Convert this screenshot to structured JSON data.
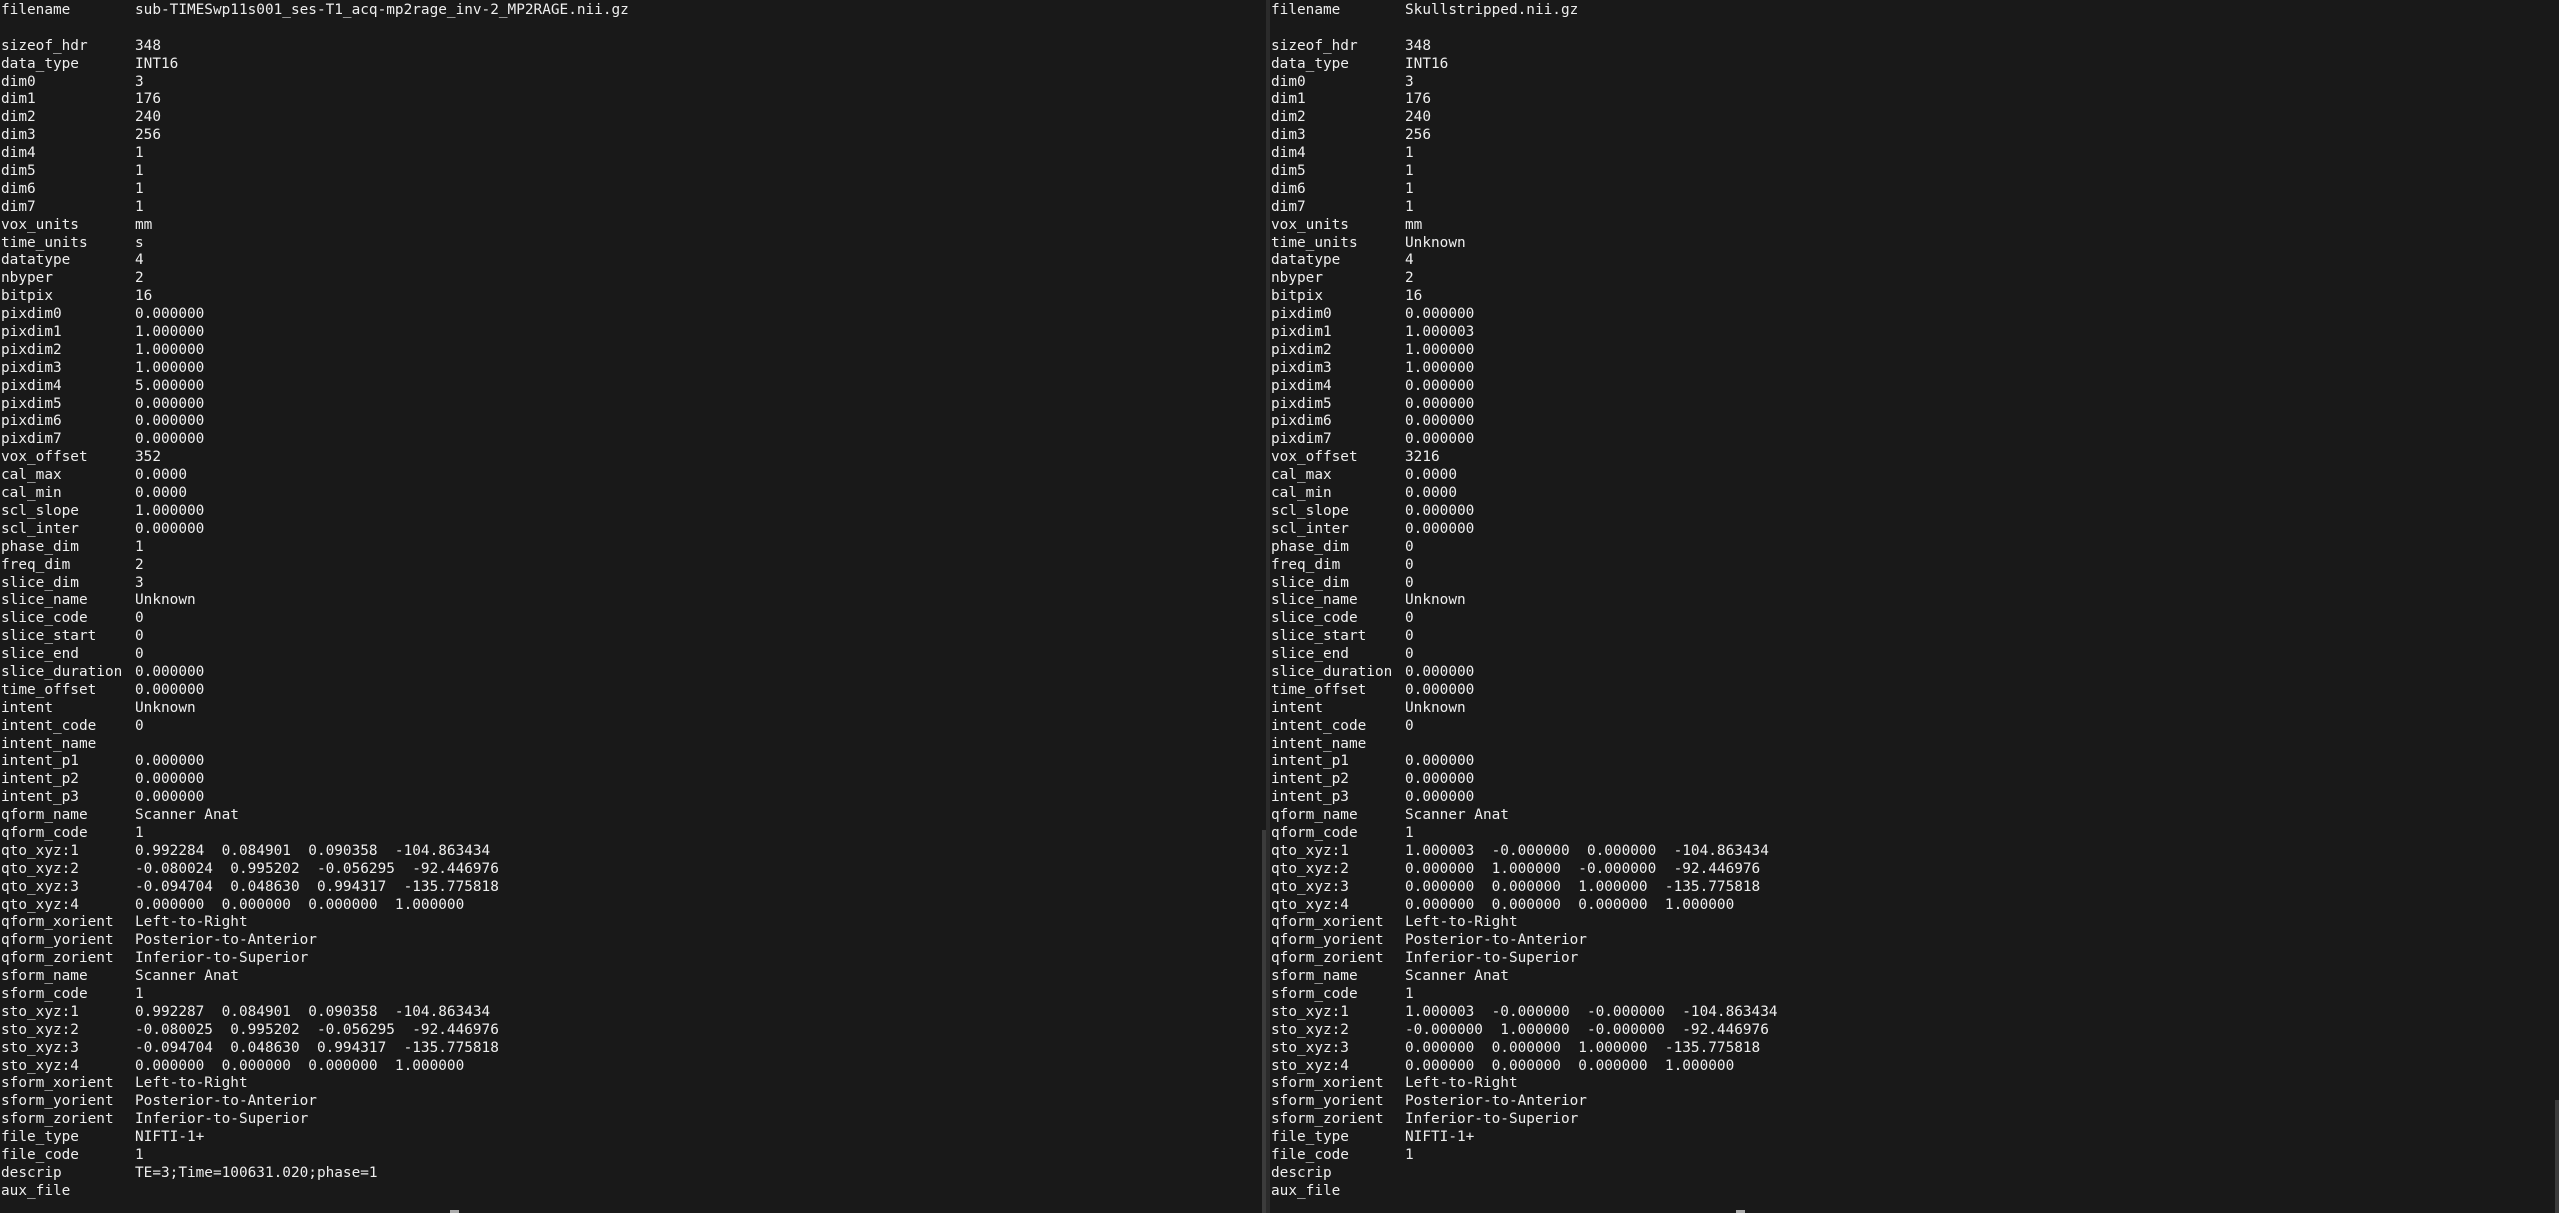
{
  "left_terminal": {
    "rows": [
      {
        "key": "filename",
        "value": "sub-TIMESwp11s001_ses-T1_acq-mp2rage_inv-2_MP2RAGE.nii.gz"
      },
      {
        "key": "",
        "value": ""
      },
      {
        "key": "sizeof_hdr",
        "value": "348"
      },
      {
        "key": "data_type",
        "value": "INT16"
      },
      {
        "key": "dim0",
        "value": "3"
      },
      {
        "key": "dim1",
        "value": "176"
      },
      {
        "key": "dim2",
        "value": "240"
      },
      {
        "key": "dim3",
        "value": "256"
      },
      {
        "key": "dim4",
        "value": "1"
      },
      {
        "key": "dim5",
        "value": "1"
      },
      {
        "key": "dim6",
        "value": "1"
      },
      {
        "key": "dim7",
        "value": "1"
      },
      {
        "key": "vox_units",
        "value": "mm"
      },
      {
        "key": "time_units",
        "value": "s"
      },
      {
        "key": "datatype",
        "value": "4"
      },
      {
        "key": "nbyper",
        "value": "2"
      },
      {
        "key": "bitpix",
        "value": "16"
      },
      {
        "key": "pixdim0",
        "value": "0.000000"
      },
      {
        "key": "pixdim1",
        "value": "1.000000"
      },
      {
        "key": "pixdim2",
        "value": "1.000000"
      },
      {
        "key": "pixdim3",
        "value": "1.000000"
      },
      {
        "key": "pixdim4",
        "value": "5.000000"
      },
      {
        "key": "pixdim5",
        "value": "0.000000"
      },
      {
        "key": "pixdim6",
        "value": "0.000000"
      },
      {
        "key": "pixdim7",
        "value": "0.000000"
      },
      {
        "key": "vox_offset",
        "value": "352"
      },
      {
        "key": "cal_max",
        "value": "0.0000"
      },
      {
        "key": "cal_min",
        "value": "0.0000"
      },
      {
        "key": "scl_slope",
        "value": "1.000000"
      },
      {
        "key": "scl_inter",
        "value": "0.000000"
      },
      {
        "key": "phase_dim",
        "value": "1"
      },
      {
        "key": "freq_dim",
        "value": "2"
      },
      {
        "key": "slice_dim",
        "value": "3"
      },
      {
        "key": "slice_name",
        "value": "Unknown"
      },
      {
        "key": "slice_code",
        "value": "0"
      },
      {
        "key": "slice_start",
        "value": "0"
      },
      {
        "key": "slice_end",
        "value": "0"
      },
      {
        "key": "slice_duration",
        "value": "0.000000"
      },
      {
        "key": "time_offset",
        "value": "0.000000"
      },
      {
        "key": "intent",
        "value": "Unknown"
      },
      {
        "key": "intent_code",
        "value": "0"
      },
      {
        "key": "intent_name",
        "value": ""
      },
      {
        "key": "intent_p1",
        "value": "0.000000"
      },
      {
        "key": "intent_p2",
        "value": "0.000000"
      },
      {
        "key": "intent_p3",
        "value": "0.000000"
      },
      {
        "key": "qform_name",
        "value": "Scanner Anat"
      },
      {
        "key": "qform_code",
        "value": "1"
      },
      {
        "key": "qto_xyz:1",
        "value": "0.992284  0.084901  0.090358  -104.863434"
      },
      {
        "key": "qto_xyz:2",
        "value": "-0.080024  0.995202  -0.056295  -92.446976"
      },
      {
        "key": "qto_xyz:3",
        "value": "-0.094704  0.048630  0.994317  -135.775818"
      },
      {
        "key": "qto_xyz:4",
        "value": "0.000000  0.000000  0.000000  1.000000"
      },
      {
        "key": "qform_xorient",
        "value": "Left-to-Right"
      },
      {
        "key": "qform_yorient",
        "value": "Posterior-to-Anterior"
      },
      {
        "key": "qform_zorient",
        "value": "Inferior-to-Superior"
      },
      {
        "key": "sform_name",
        "value": "Scanner Anat"
      },
      {
        "key": "sform_code",
        "value": "1"
      },
      {
        "key": "sto_xyz:1",
        "value": "0.992287  0.084901  0.090358  -104.863434"
      },
      {
        "key": "sto_xyz:2",
        "value": "-0.080025  0.995202  -0.056295  -92.446976"
      },
      {
        "key": "sto_xyz:3",
        "value": "-0.094704  0.048630  0.994317  -135.775818"
      },
      {
        "key": "sto_xyz:4",
        "value": "0.000000  0.000000  0.000000  1.000000"
      },
      {
        "key": "sform_xorient",
        "value": "Left-to-Right"
      },
      {
        "key": "sform_yorient",
        "value": "Posterior-to-Anterior"
      },
      {
        "key": "sform_zorient",
        "value": "Inferior-to-Superior"
      },
      {
        "key": "file_type",
        "value": "NIFTI-1+"
      },
      {
        "key": "file_code",
        "value": "1"
      },
      {
        "key": "descrip",
        "value": "TE=3;Time=100631.020;phase=1"
      },
      {
        "key": "aux_file",
        "value": ""
      }
    ]
  },
  "right_terminal": {
    "rows": [
      {
        "key": "filename",
        "value": "Skullstripped.nii.gz"
      },
      {
        "key": "",
        "value": ""
      },
      {
        "key": "sizeof_hdr",
        "value": "348"
      },
      {
        "key": "data_type",
        "value": "INT16"
      },
      {
        "key": "dim0",
        "value": "3"
      },
      {
        "key": "dim1",
        "value": "176"
      },
      {
        "key": "dim2",
        "value": "240"
      },
      {
        "key": "dim3",
        "value": "256"
      },
      {
        "key": "dim4",
        "value": "1"
      },
      {
        "key": "dim5",
        "value": "1"
      },
      {
        "key": "dim6",
        "value": "1"
      },
      {
        "key": "dim7",
        "value": "1"
      },
      {
        "key": "vox_units",
        "value": "mm"
      },
      {
        "key": "time_units",
        "value": "Unknown"
      },
      {
        "key": "datatype",
        "value": "4"
      },
      {
        "key": "nbyper",
        "value": "2"
      },
      {
        "key": "bitpix",
        "value": "16"
      },
      {
        "key": "pixdim0",
        "value": "0.000000"
      },
      {
        "key": "pixdim1",
        "value": "1.000003"
      },
      {
        "key": "pixdim2",
        "value": "1.000000"
      },
      {
        "key": "pixdim3",
        "value": "1.000000"
      },
      {
        "key": "pixdim4",
        "value": "0.000000"
      },
      {
        "key": "pixdim5",
        "value": "0.000000"
      },
      {
        "key": "pixdim6",
        "value": "0.000000"
      },
      {
        "key": "pixdim7",
        "value": "0.000000"
      },
      {
        "key": "vox_offset",
        "value": "3216"
      },
      {
        "key": "cal_max",
        "value": "0.0000"
      },
      {
        "key": "cal_min",
        "value": "0.0000"
      },
      {
        "key": "scl_slope",
        "value": "0.000000"
      },
      {
        "key": "scl_inter",
        "value": "0.000000"
      },
      {
        "key": "phase_dim",
        "value": "0"
      },
      {
        "key": "freq_dim",
        "value": "0"
      },
      {
        "key": "slice_dim",
        "value": "0"
      },
      {
        "key": "slice_name",
        "value": "Unknown"
      },
      {
        "key": "slice_code",
        "value": "0"
      },
      {
        "key": "slice_start",
        "value": "0"
      },
      {
        "key": "slice_end",
        "value": "0"
      },
      {
        "key": "slice_duration",
        "value": "0.000000"
      },
      {
        "key": "time_offset",
        "value": "0.000000"
      },
      {
        "key": "intent",
        "value": "Unknown"
      },
      {
        "key": "intent_code",
        "value": "0"
      },
      {
        "key": "intent_name",
        "value": ""
      },
      {
        "key": "intent_p1",
        "value": "0.000000"
      },
      {
        "key": "intent_p2",
        "value": "0.000000"
      },
      {
        "key": "intent_p3",
        "value": "0.000000"
      },
      {
        "key": "qform_name",
        "value": "Scanner Anat"
      },
      {
        "key": "qform_code",
        "value": "1"
      },
      {
        "key": "qto_xyz:1",
        "value": "1.000003  -0.000000  0.000000  -104.863434"
      },
      {
        "key": "qto_xyz:2",
        "value": "0.000000  1.000000  -0.000000  -92.446976"
      },
      {
        "key": "qto_xyz:3",
        "value": "0.000000  0.000000  1.000000  -135.775818"
      },
      {
        "key": "qto_xyz:4",
        "value": "0.000000  0.000000  0.000000  1.000000"
      },
      {
        "key": "qform_xorient",
        "value": "Left-to-Right"
      },
      {
        "key": "qform_yorient",
        "value": "Posterior-to-Anterior"
      },
      {
        "key": "qform_zorient",
        "value": "Inferior-to-Superior"
      },
      {
        "key": "sform_name",
        "value": "Scanner Anat"
      },
      {
        "key": "sform_code",
        "value": "1"
      },
      {
        "key": "sto_xyz:1",
        "value": "1.000003  -0.000000  -0.000000  -104.863434"
      },
      {
        "key": "sto_xyz:2",
        "value": "-0.000000  1.000000  -0.000000  -92.446976"
      },
      {
        "key": "sto_xyz:3",
        "value": "0.000000  0.000000  1.000000  -135.775818"
      },
      {
        "key": "sto_xyz:4",
        "value": "0.000000  0.000000  0.000000  1.000000"
      },
      {
        "key": "sform_xorient",
        "value": "Left-to-Right"
      },
      {
        "key": "sform_yorient",
        "value": "Posterior-to-Anterior"
      },
      {
        "key": "sform_zorient",
        "value": "Inferior-to-Superior"
      },
      {
        "key": "file_type",
        "value": "NIFTI-1+"
      },
      {
        "key": "file_code",
        "value": "1"
      },
      {
        "key": "descrip",
        "value": ""
      },
      {
        "key": "aux_file",
        "value": ""
      }
    ]
  }
}
